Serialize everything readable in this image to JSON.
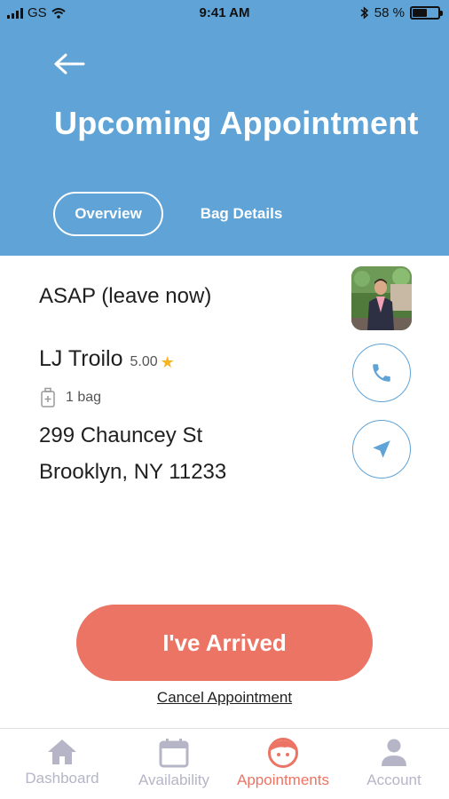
{
  "status_bar": {
    "carrier": "GS",
    "time": "9:41 AM",
    "battery": "58 %",
    "battery_level": 0.58
  },
  "header": {
    "title": "Upcoming Appointment",
    "tabs": [
      {
        "label": "Overview",
        "active": true
      },
      {
        "label": "Bag Details",
        "active": false
      }
    ]
  },
  "appointment": {
    "when": "ASAP (leave now)",
    "name": "LJ Troilo",
    "rating": "5.00",
    "bags": "1 bag",
    "address_line1": "299 Chauncey St",
    "address_line2": "Brooklyn, NY 11233"
  },
  "actions": {
    "arrived_label": "I've Arrived",
    "cancel_label": "Cancel Appointment"
  },
  "bottom_nav": [
    {
      "label": "Dashboard",
      "icon": "home-icon",
      "active": false
    },
    {
      "label": "Availability",
      "icon": "calendar-icon",
      "active": false
    },
    {
      "label": "Appointments",
      "icon": "face-icon",
      "active": true
    },
    {
      "label": "Account",
      "icon": "person-icon",
      "active": false
    }
  ],
  "colors": {
    "header_blue": "#5fa3d7",
    "accent_coral": "#ec7464",
    "inactive_gray": "#b5b5c7",
    "star_gold": "#f5b422"
  }
}
